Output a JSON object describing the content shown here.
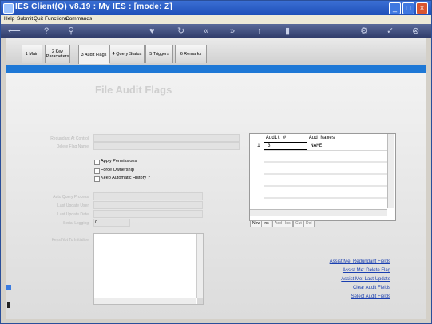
{
  "window": {
    "title": "IES Client(Q) v8.19 : My IES :       [mode: Z]"
  },
  "menu": [
    "Help",
    "Submit",
    "Quit",
    "Functions",
    "Commands"
  ],
  "tabs": [
    {
      "label": "1 Main"
    },
    {
      "label": "2 Key Parameters"
    },
    {
      "label": "3 Audit Flags"
    },
    {
      "label": "4 Query Status"
    },
    {
      "label": "5 Triggers"
    },
    {
      "label": "6 Remarks"
    }
  ],
  "form": {
    "heading": "File Audit Flags",
    "labels": {
      "redundant": "Redundant At Control",
      "delete_flag": "Delete Flag Name",
      "auto_query": "Auto Query Process",
      "last_update_user": "Last Update User",
      "last_update_date": "Last Update Date",
      "serial_logging": "Serial Logging",
      "keys_not_to_initialize": "Keys Not To Initialize"
    },
    "serial_logging_value": "0",
    "checkboxes": [
      "Apply Permissions",
      "Force Ownership",
      "Keep Automatic History ?"
    ]
  },
  "grid": {
    "columns": [
      "Audit #",
      "Aud Names"
    ],
    "rows": [
      {
        "num": "1",
        "audit": "3",
        "name": "NAME"
      }
    ],
    "nav_buttons": [
      "New",
      "Ins",
      "Add",
      "Ins",
      "Cut",
      "Del"
    ]
  },
  "links": [
    "Assist Me: Redundant Fields",
    "Assist Me: Delete Flag",
    "Assist Me: Last Update",
    "Clear Audit Fields",
    "Select Audit Fields"
  ],
  "colors": {
    "accent": "#1e78d6",
    "title_bar": "#2a5cc4",
    "link": "#1a3fb0"
  }
}
